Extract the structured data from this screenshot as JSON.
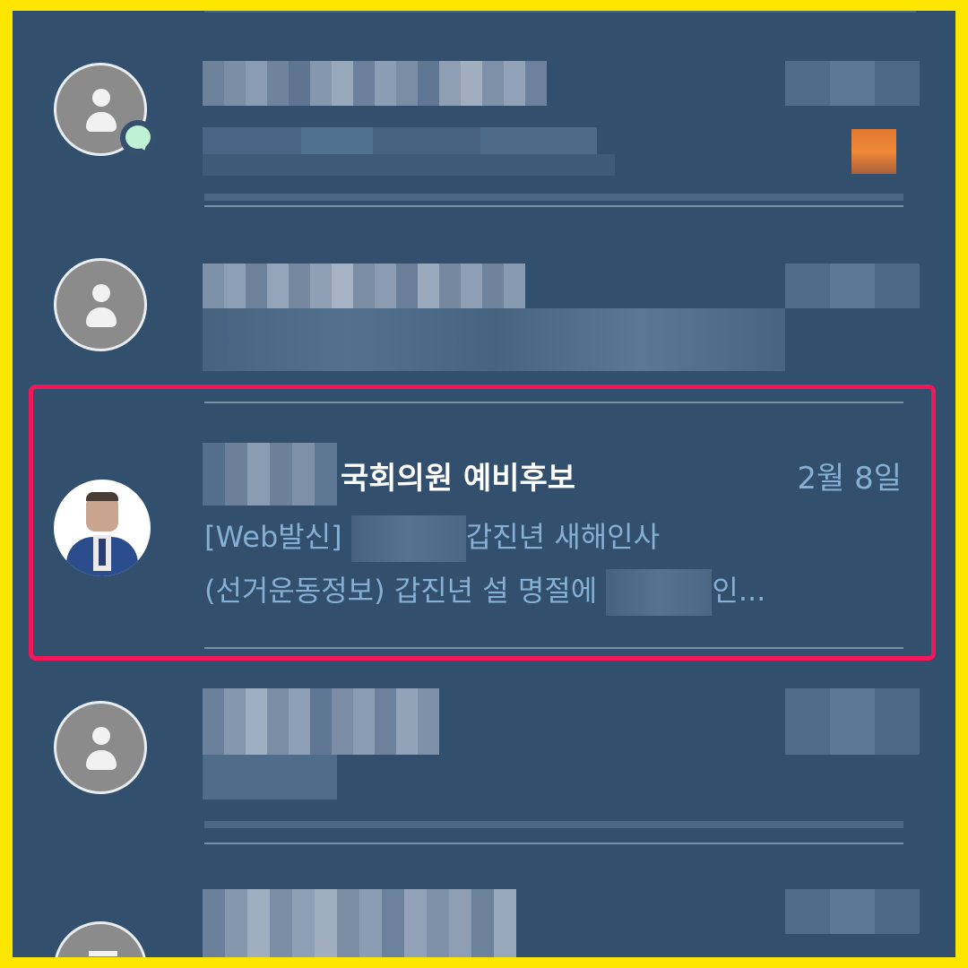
{
  "highlighted": {
    "title": "국회의원 예비후보",
    "date": "2월 8일",
    "preview_line1_prefix": "[Web발신] ",
    "preview_line1_suffix": "갑진년 새해인사",
    "preview_line2_prefix": "(선거운동정보) 갑진년 설 명절에 ",
    "preview_line2_suffix": "인..."
  },
  "colors": {
    "outer_border": "#ffe600",
    "background": "#32506e",
    "highlight": "#f2175a",
    "secondary_text": "#86b0d3",
    "unread_badge": "#bff1d4"
  },
  "icons": [
    "person-icon",
    "chat-bubble-icon",
    "document-icon"
  ]
}
